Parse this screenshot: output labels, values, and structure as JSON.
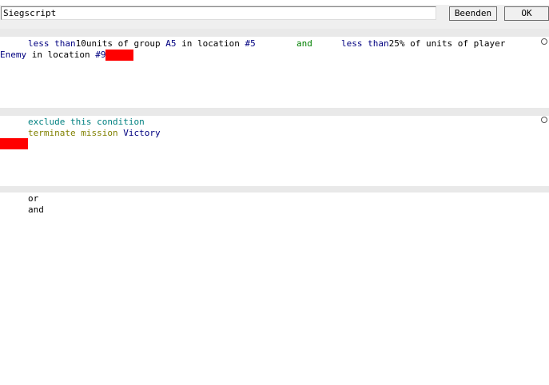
{
  "toolbar": {
    "script_name": "Siegscript",
    "quit_label": "Beenden",
    "ok_label": "OK"
  },
  "conditions": {
    "line1": {
      "cmp1": "less than",
      "num1": "10",
      "t1": "units of group ",
      "group": "A5",
      "t2": " in location ",
      "loc1": "#5",
      "join": "and",
      "cmp2": "less than",
      "num2": "25",
      "t3": "% of units of player"
    },
    "line2": {
      "player": "Enemy",
      "t1": " in location ",
      "loc2": "#9"
    }
  },
  "actions": {
    "line1": "exclude this condition",
    "line2_cmd": "terminate mission ",
    "line2_val": "Victory"
  },
  "palette": {
    "items": [
      "or",
      "and"
    ]
  }
}
